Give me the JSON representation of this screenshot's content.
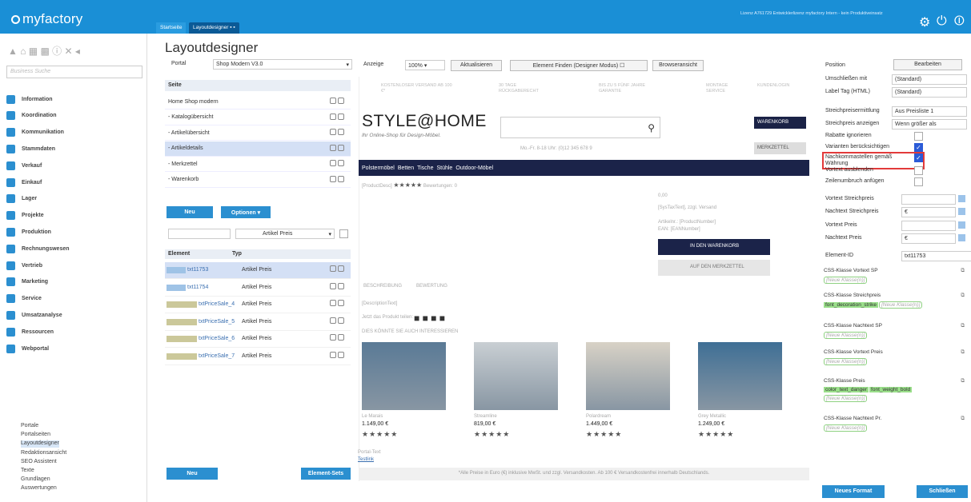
{
  "app": {
    "logo": "myfactory",
    "license": "Lizenz A761729 Entwicklerlizenz myfactory Intern - kein Produktiveinsatz"
  },
  "tabs": [
    {
      "label": "Startseite"
    },
    {
      "label": "Layoutdesigner"
    }
  ],
  "sidebar": {
    "search_placeholder": "Business Suche",
    "items": [
      "Information",
      "Koordination",
      "Kommunikation",
      "Stammdaten",
      "Verkauf",
      "Einkauf",
      "Lager",
      "Projekte",
      "Produktion",
      "Rechnungswesen",
      "Vertrieb",
      "Marketing",
      "Service",
      "Umsatzanalyse",
      "Ressourcen",
      "Webportal"
    ],
    "subitems": [
      "Portale",
      "Portalseiten",
      "Layoutdesigner",
      "Redaktionsansicht",
      "SEO Assistent",
      "Texte",
      "Grundlagen",
      "Auswertungen"
    ]
  },
  "page_title": "Layoutdesigner",
  "portal": {
    "label": "Portal",
    "value": "Shop Modern V3.0"
  },
  "toolbar": {
    "anzeige": "Anzeige",
    "zoom": "100%",
    "refresh": "Aktualisieren",
    "find": "Element Finden (Designer Modus)",
    "browser": "Browseransicht"
  },
  "pages_header": "Seite",
  "pages": [
    "Home Shop modern",
    "- Katalogübersicht",
    "- Artikelübersicht",
    "- Artikeldetails",
    "- Merkzettel",
    "- Warenkorb"
  ],
  "btn_neu": "Neu",
  "btn_optionen": "Optionen ▾",
  "filter_value": "Artikel Preis",
  "elem_headers": {
    "element": "Element",
    "typ": "Typ"
  },
  "elements": [
    {
      "name": "txt11753",
      "type": "Artikel Preis"
    },
    {
      "name": "txt11754",
      "type": "Artikel Preis"
    },
    {
      "name": "txtPriceSale_4",
      "type": "Artikel Preis"
    },
    {
      "name": "txtPriceSale_5",
      "type": "Artikel Preis"
    },
    {
      "name": "txtPriceSale_6",
      "type": "Artikel Preis"
    },
    {
      "name": "txtPriceSale_7",
      "type": "Artikel Preis"
    }
  ],
  "btn_neu2": "Neu",
  "btn_elementsets": "Element-Sets",
  "shop": {
    "promo1": "KOSTENLOSER VERSAND AB 100 €*",
    "promo2": "30 TAGE RÜCKGABERECHT",
    "promo3": "BIS ZU 5 FÜNF JAHRE GARANTIE",
    "promo4": "MONTAGE SERVICE",
    "login": "KUNDENLOGIN",
    "brand": "STYLE@HOME",
    "brand_sub": "Ihr Online-Shop für Design-Möbel.",
    "cart": "WARENKORB",
    "watch": "MERKZETTEL",
    "phone": "Mo.-Fr. 8-18 Uhr: (0)12 345 678 9",
    "cats": [
      "Polstermöbel",
      "Betten",
      "Tische",
      "Stühle",
      "Outdoor-Möbel"
    ],
    "desc": "[ProductDesc]",
    "ratings": "Bewertungen: 0",
    "price": "0,00",
    "tax": "[SysTaxText], zzgl. Versand",
    "artno": "Artikelnr.: [ProductNumber]",
    "ean": "EAN: [EANNumber]",
    "add_cart": "IN DEN WARENKORB",
    "add_watch": "AUF DEN MERKZETTEL",
    "tab1": "BESCHREIBUNG",
    "tab2": "BEWERTUNG",
    "desctext": "[DescriptionText]",
    "share": "Jetzt das Produkt teilen:",
    "suggest": "DIES KÖNNTE SIE AUCH INTERESSIEREN",
    "products": [
      {
        "name": "Le Marais",
        "price": "1.149,00 €"
      },
      {
        "name": "Streamline",
        "price": "819,00 €"
      },
      {
        "name": "Polardream",
        "price": "1.449,00 €"
      },
      {
        "name": "Grey Metallic",
        "price": "1.249,00 €"
      }
    ],
    "portal_text": "Portal-Text",
    "testlink": "Testlink",
    "footer": "*Alle Preise in Euro (€) inklusive MwSt. und zzgl. Versandkosten. Ab 100 € Versandkostenfrei innerhalb Deutschlands."
  },
  "props": {
    "position": "Position",
    "bearbeiten": "Bearbeiten",
    "umschl": "Umschließen mit",
    "umschl_v": "(Standard)",
    "labeltag": "Label Tag (HTML)",
    "labeltag_v": "(Standard)",
    "streich": "Streichpreisermittlung",
    "streich_v": "Aus Preisliste 1",
    "streichanz": "Streichpreis anzeigen",
    "streichanz_v": "Wenn größer als",
    "rabatte": "Rabatte ignorieren",
    "varianten": "Varianten berücksichtigen",
    "nachkomma": "Nachkommastellen gemäß Währung",
    "vortext_aus": "Vortext ausblenden",
    "zeilen": "Zeilenumbruch anfügen",
    "vs": "Vortext Streichpreis",
    "ns": "Nachtext Streichpreis",
    "ns_v": "€",
    "vp": "Vortext Preis",
    "np": "Nachtext Preis",
    "np_v": "€",
    "eid": "Element-ID",
    "eid_v": "txt11753",
    "css1": "CSS-Klasse Vortext SP",
    "css2": "CSS-Klasse Streichpreis",
    "css2_tag": "font_decoration_strike",
    "css3": "CSS-Klasse Nachtext SP",
    "css4": "CSS-Klasse Vortext Preis",
    "css5": "CSS-Klasse Preis",
    "css5_tag1": "color_text_danger",
    "css5_tag2": "font_weight_bold",
    "css6": "CSS-Klasse Nachtext Pr.",
    "placeholder": "[Neue Klasse(n)]",
    "neues_format": "Neues Format",
    "schliessen": "Schließen"
  }
}
